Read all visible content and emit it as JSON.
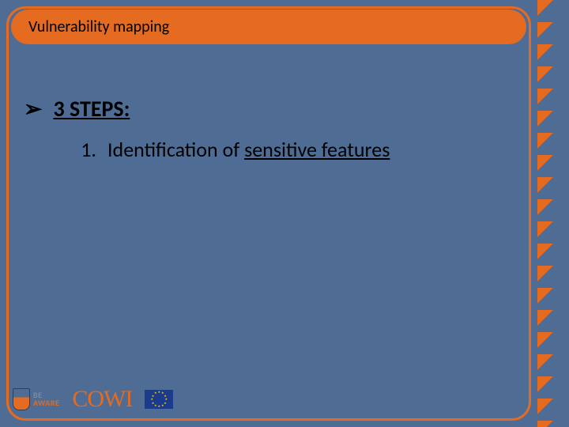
{
  "title": "Vulnerability mapping",
  "bullet": {
    "arrow": "➢",
    "label": "3 STEPS:"
  },
  "step": {
    "number": "1.",
    "prefix": "Identification of ",
    "highlight": "sensitive features"
  },
  "logos": {
    "beaware_top": "BE",
    "beaware_bottom": "AWARE",
    "cowi": "COWI"
  }
}
